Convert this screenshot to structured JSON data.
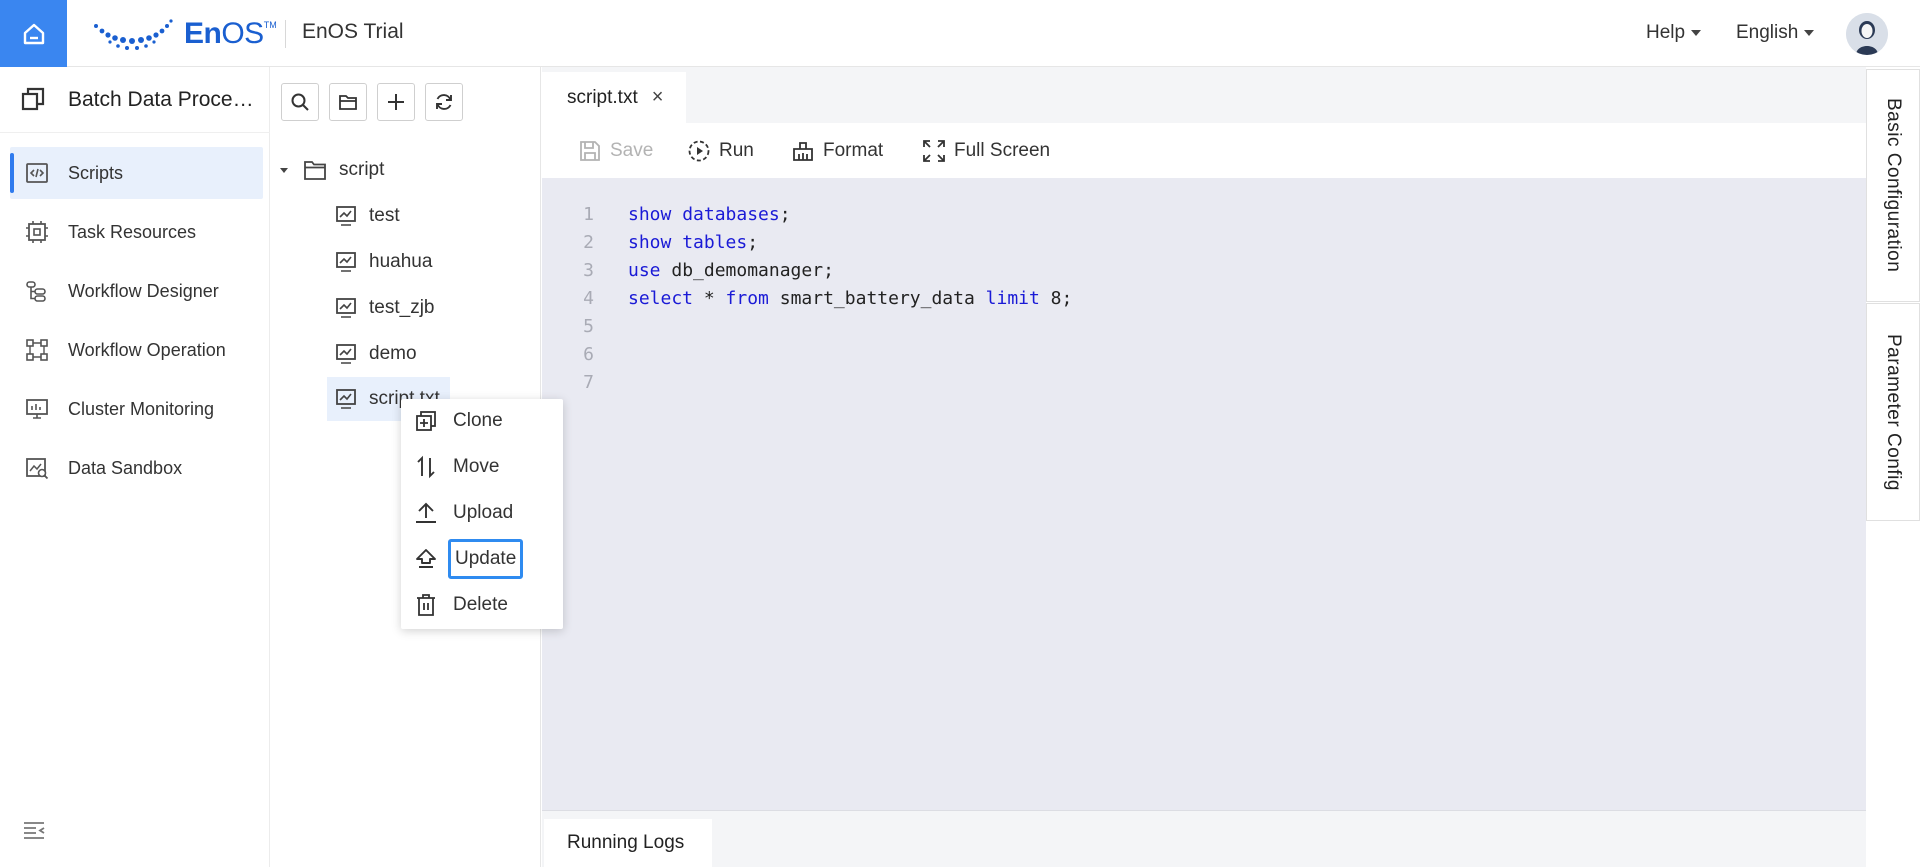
{
  "header": {
    "logo_text_en": "En",
    "logo_text_os": "OS",
    "logo_tm": "TM",
    "product_name": "EnOS Trial",
    "help_label": "Help",
    "language_label": "English",
    "brand_color": "#3a86f0"
  },
  "nav": {
    "title": "Batch Data Processing",
    "items": [
      {
        "label": "Scripts",
        "icon": "script-icon",
        "active": true
      },
      {
        "label": "Task Resources",
        "icon": "chip-icon"
      },
      {
        "label": "Workflow Designer",
        "icon": "workflow-designer-icon"
      },
      {
        "label": "Workflow Operation",
        "icon": "workflow-operation-icon"
      },
      {
        "label": "Cluster Monitoring",
        "icon": "monitor-icon"
      },
      {
        "label": "Data Sandbox",
        "icon": "sandbox-icon"
      }
    ]
  },
  "tree": {
    "toolbar": [
      "search-icon",
      "folder-icon",
      "plus-icon",
      "refresh-icon"
    ],
    "root": "script",
    "files": [
      "test",
      "huahua",
      "test_zjb",
      "demo",
      "script.txt"
    ],
    "selected_file": "script.txt"
  },
  "context_menu": {
    "items": [
      {
        "label": "Clone",
        "icon": "clone-icon"
      },
      {
        "label": "Move",
        "icon": "move-icon"
      },
      {
        "label": "Upload",
        "icon": "upload-icon"
      },
      {
        "label": "Update",
        "icon": "update-icon",
        "focused": true
      },
      {
        "label": "Delete",
        "icon": "delete-icon"
      }
    ]
  },
  "editor": {
    "tab_label": "script.txt",
    "tab_close": "×",
    "toolbar": {
      "save": "Save",
      "run": "Run",
      "format": "Format",
      "fullscreen": "Full Screen"
    },
    "lines": [
      {
        "n": "1",
        "text": "show databases;"
      },
      {
        "n": "2",
        "text": "show tables;"
      },
      {
        "n": "3",
        "text": "use db_demomanager;"
      },
      {
        "n": "4",
        "text": "select * from smart_battery_data limit 8;"
      },
      {
        "n": "5",
        "text": ""
      },
      {
        "n": "6",
        "text": ""
      },
      {
        "n": "7",
        "text": ""
      }
    ],
    "keyword_color": "#1a1ad6",
    "logs_tab": "Running Logs"
  },
  "right_tabs": {
    "basic": "Basic Configuration",
    "param": "Parameter Config"
  }
}
